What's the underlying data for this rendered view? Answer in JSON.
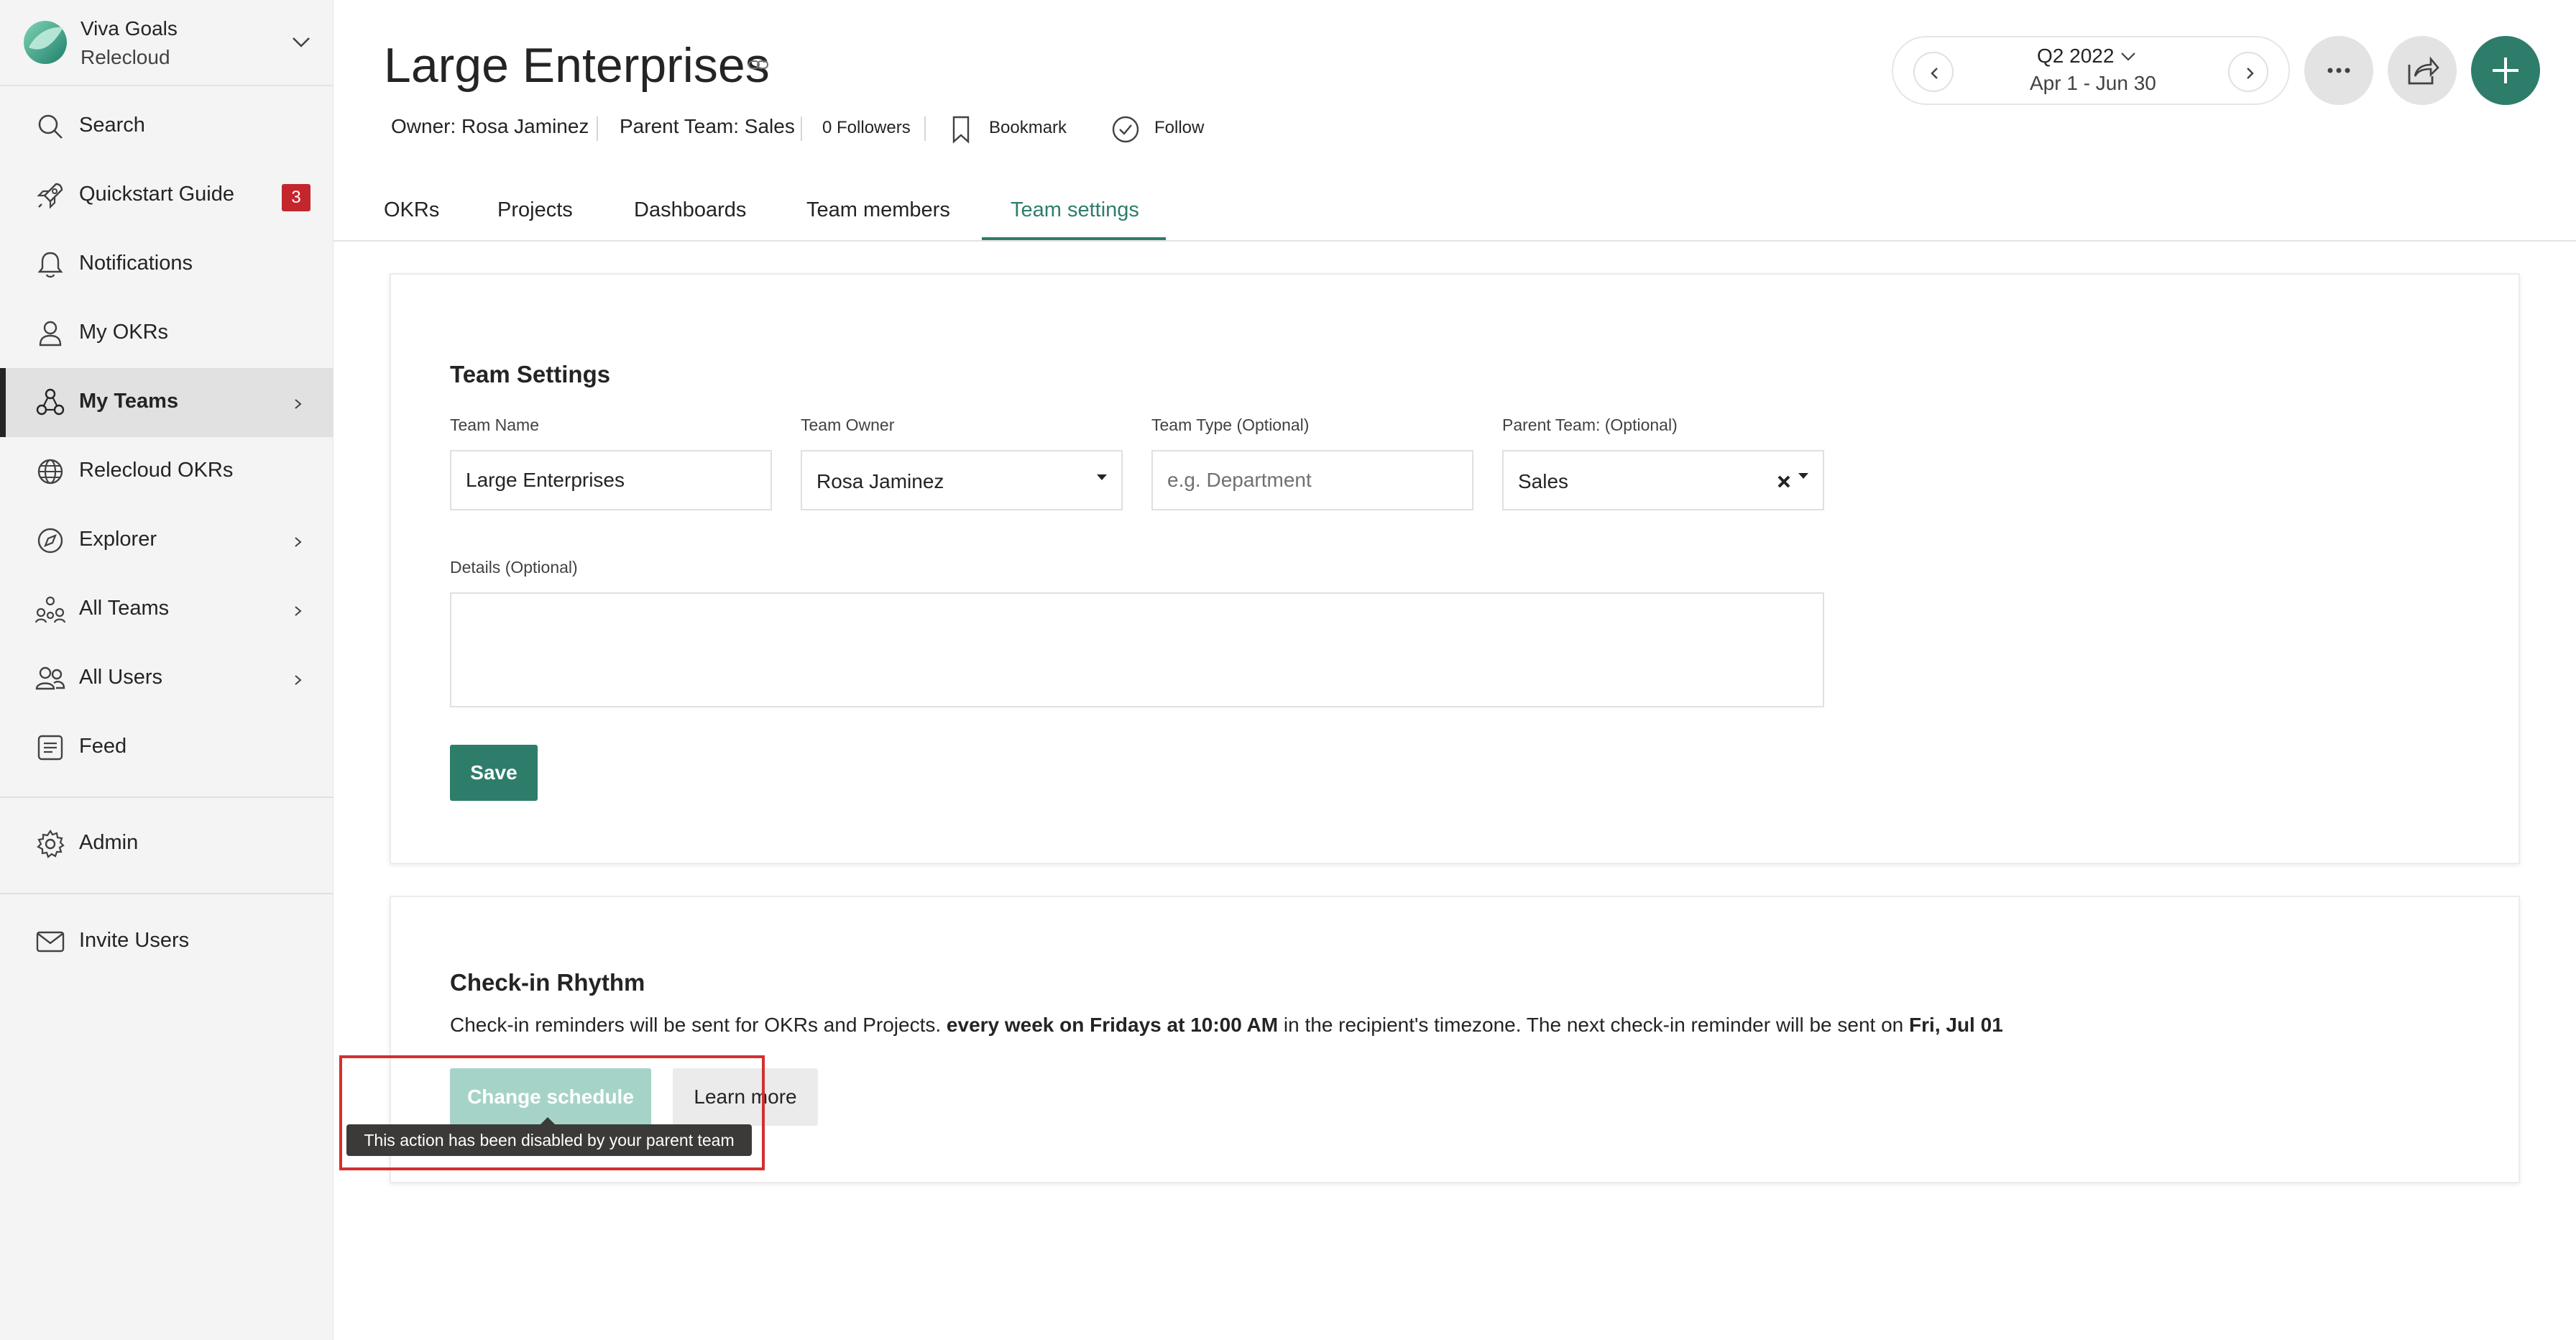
{
  "app": {
    "name": "Viva Goals",
    "org": "Relecloud"
  },
  "sidebar": {
    "items": [
      {
        "label": "Search",
        "icon": "search-icon"
      },
      {
        "label": "Quickstart Guide",
        "icon": "rocket-icon",
        "badge": "3"
      },
      {
        "label": "Notifications",
        "icon": "bell-icon"
      },
      {
        "label": "My OKRs",
        "icon": "person-icon"
      },
      {
        "label": "My Teams",
        "icon": "team-icon",
        "active": true
      },
      {
        "label": "Relecloud OKRs",
        "icon": "globe-icon"
      },
      {
        "label": "Explorer",
        "icon": "compass-icon"
      },
      {
        "label": "All Teams",
        "icon": "people-group-icon"
      },
      {
        "label": "All Users",
        "icon": "people-icon"
      },
      {
        "label": "Feed",
        "icon": "feed-icon"
      },
      {
        "label": "Admin",
        "icon": "gear-icon"
      },
      {
        "label": "Invite Users",
        "icon": "mail-icon"
      }
    ]
  },
  "header": {
    "title": "Large Enterprises",
    "owner": "Owner: Rosa Jaminez",
    "parent_team": "Parent Team: Sales",
    "followers": "0 Followers",
    "bookmark": "Bookmark",
    "follow": "Follow"
  },
  "period": {
    "quarter": "Q2 2022",
    "range": "Apr 1 - Jun 30"
  },
  "tabs": [
    "OKRs",
    "Projects",
    "Dashboards",
    "Team members",
    "Team settings"
  ],
  "active_tab": "Team settings",
  "team_settings": {
    "title": "Team Settings",
    "team_name_label": "Team Name",
    "team_name_value": "Large Enterprises",
    "team_owner_label": "Team Owner",
    "team_owner_value": "Rosa Jaminez",
    "team_type_label": "Team Type (Optional)",
    "team_type_placeholder": "e.g. Department",
    "parent_team_label": "Parent Team: (Optional)",
    "parent_team_value": "Sales",
    "details_label": "Details (Optional)",
    "save_label": "Save"
  },
  "checkin": {
    "title": "Check-in Rhythm",
    "text_1": "Check-in reminders will be sent for OKRs and Projects. ",
    "text_bold_1": "every week on Fridays at 10:00 AM",
    "text_2": " in the recipient's timezone. The next check-in reminder will be sent on ",
    "text_bold_2": "Fri, Jul 01",
    "change_label": "Change schedule",
    "learn_label": "Learn more",
    "tooltip": "This action has been disabled by your parent team"
  },
  "colors": {
    "accent": "#2e7d6b",
    "accent_disabled": "#a6d3c8",
    "badge": "#c4262e",
    "highlight": "#d32f2f"
  }
}
